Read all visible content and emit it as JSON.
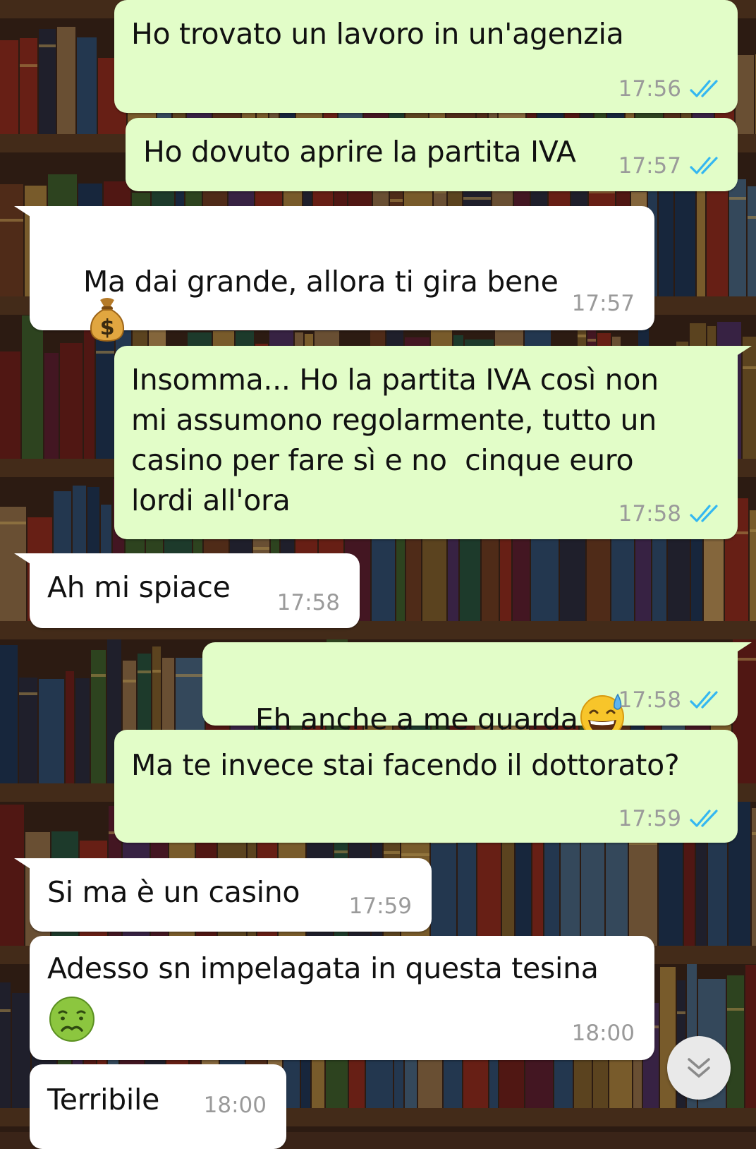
{
  "messages": [
    {
      "id": "m1",
      "dir": "out",
      "text": "Ho trovato un lavoro in un'agenzia",
      "time": "17:56",
      "status": "read"
    },
    {
      "id": "m2",
      "dir": "out",
      "text": "Ho dovuto aprire la partita IVA",
      "time": "17:57",
      "status": "read"
    },
    {
      "id": "m3",
      "dir": "in",
      "text": "Ma dai grande, allora ti gira bene",
      "emoji": "money-bag",
      "time": "17:57"
    },
    {
      "id": "m4",
      "dir": "out",
      "text": "Insomma... Ho la partita IVA così non\nmi assumono regolarmente, tutto un\ncasino per fare sì e no  cinque euro\nlordi all'ora",
      "time": "17:58",
      "status": "read"
    },
    {
      "id": "m5",
      "dir": "in",
      "text": "Ah mi spiace",
      "time": "17:58"
    },
    {
      "id": "m6",
      "dir": "out",
      "text": "Eh anche a me guarda",
      "emoji": "grinning-sweat",
      "time": "17:58",
      "status": "read"
    },
    {
      "id": "m7",
      "dir": "out",
      "text": "Ma te invece stai facendo il dottorato?",
      "time": "17:59",
      "status": "read"
    },
    {
      "id": "m8",
      "dir": "in",
      "text": "Si ma è un casino",
      "time": "17:59"
    },
    {
      "id": "m9",
      "dir": "in",
      "text": "Adesso sn impelagata in questa tesina",
      "emoji": "nauseated-face",
      "time": "18:00"
    },
    {
      "id": "m10",
      "dir": "in",
      "text": "Terribile",
      "time": "18:00"
    }
  ],
  "icons": {
    "read_receipt": "double-check-icon",
    "scroll_button": "chevron-double-down-icon"
  },
  "colors": {
    "outgoing_bubble": "#e2fdc8",
    "incoming_bubble": "#ffffff",
    "read_tick": "#34b7f1",
    "timestamp": "#9a9a9a"
  }
}
